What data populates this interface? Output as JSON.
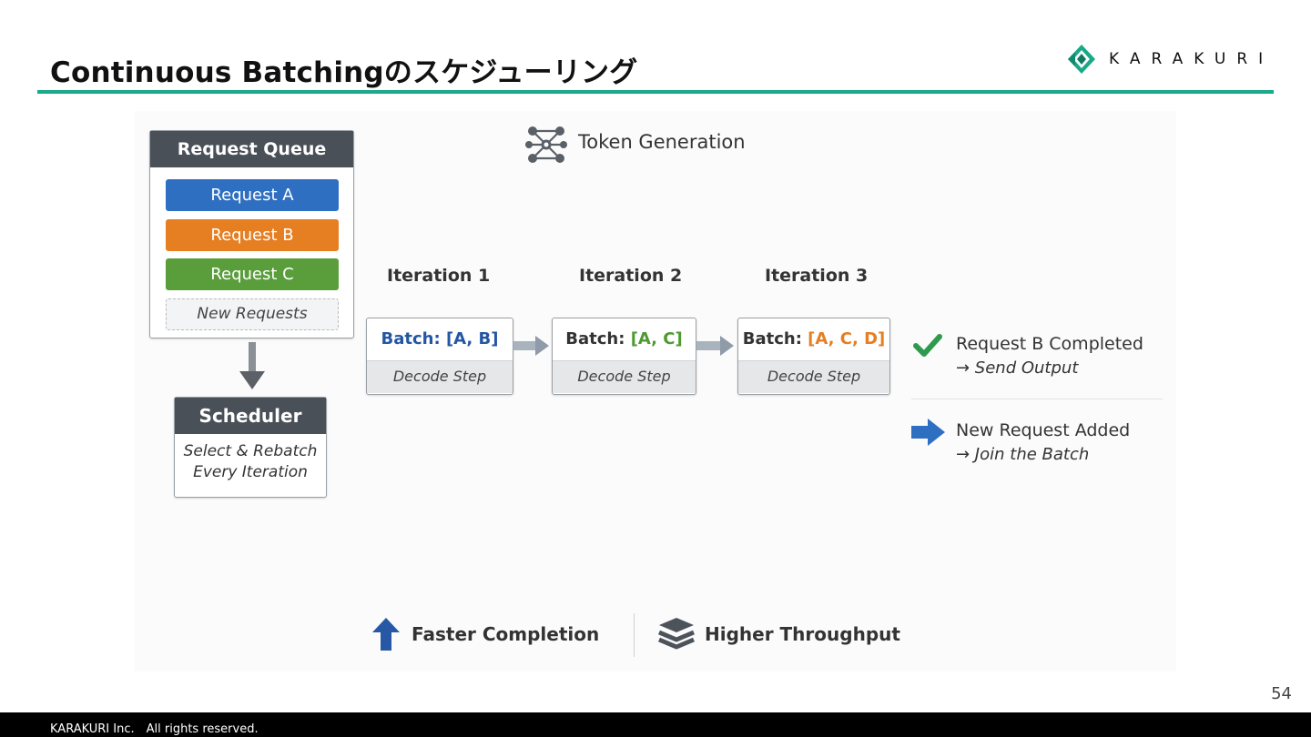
{
  "slide": {
    "title": "Continuous Batchingのスケジューリング",
    "logo_text": "KARAKURI",
    "page_number": "54",
    "footer": "KARAKURI Inc.　All rights reserved.",
    "accent_color": "#1aa98a"
  },
  "diagram": {
    "token_generation_label": "Token Generation",
    "request_queue": {
      "title": "Request Queue",
      "items": [
        {
          "label": "Request A",
          "color": "#2f6fc2"
        },
        {
          "label": "Request B",
          "color": "#e67e22"
        },
        {
          "label": "Request C",
          "color": "#5a9e3b"
        }
      ],
      "new_requests_label": "New Requests"
    },
    "scheduler": {
      "title": "Scheduler",
      "line1": "Select & Rebatch",
      "line2": "Every Iteration"
    },
    "iterations": [
      {
        "label": "Iteration 1",
        "batch_prefix": "Batch: ",
        "batch_value": "[A, B]",
        "value_color": "#2356a3",
        "step": "Decode Step"
      },
      {
        "label": "Iteration 2",
        "batch_prefix": "Batch: ",
        "batch_value": "[A, C]",
        "value_color": "#4f9a2f",
        "step": "Decode Step"
      },
      {
        "label": "Iteration 3",
        "batch_prefix": "Batch: ",
        "batch_value": "[A, C, D]",
        "value_color": "#e67e22",
        "step": "Decode Step"
      }
    ],
    "notes": [
      {
        "line1": "Request B Completed",
        "line2": "→ Send Output",
        "icon": "check-icon",
        "icon_color": "#2e9a4e"
      },
      {
        "line1": "New Request Added",
        "line2": "→ Join the Batch",
        "icon": "arrow-right-icon",
        "icon_color": "#2f6fc2"
      }
    ],
    "benefits": [
      {
        "label": "Faster Completion",
        "icon": "arrow-up-icon"
      },
      {
        "label": "Higher Throughput",
        "icon": "layers-icon"
      }
    ]
  }
}
